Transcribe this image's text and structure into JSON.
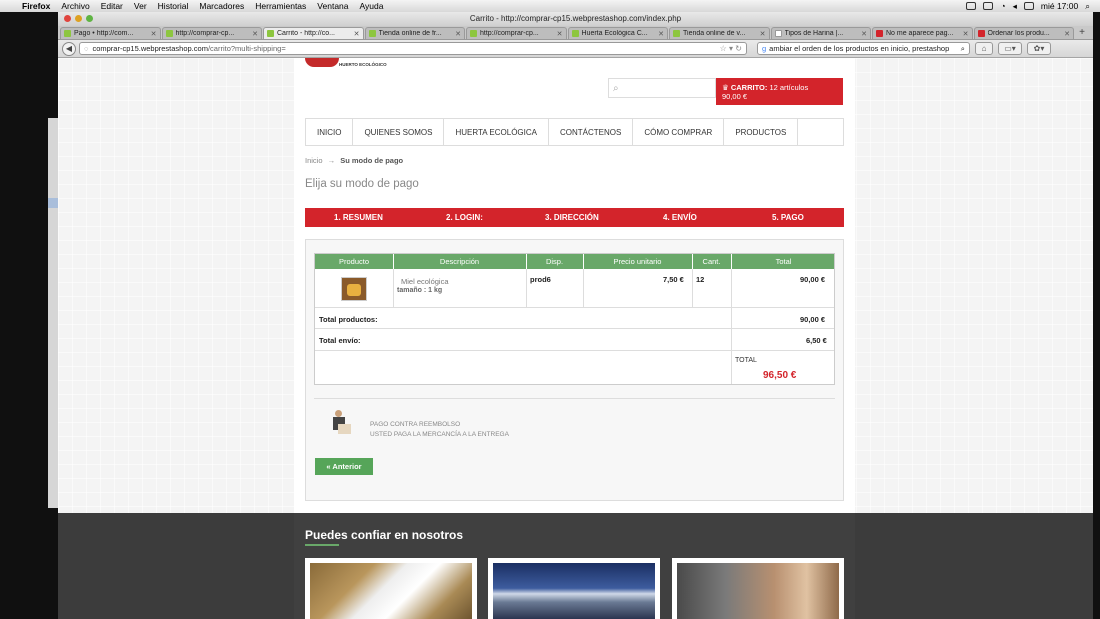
{
  "menubar": {
    "app": "Firefox",
    "items": [
      "Archivo",
      "Editar",
      "Ver",
      "Historial",
      "Marcadores",
      "Herramientas",
      "Ventana",
      "Ayuda"
    ],
    "clock": "mié 17:00"
  },
  "window": {
    "title": "Carrito - http://comprar-cp15.webprestashop.com/index.php"
  },
  "tabs": [
    {
      "label": "Pago • http://com...",
      "color": "#8dc63f",
      "active": false
    },
    {
      "label": "http://comprar-cp...",
      "color": "#8dc63f",
      "active": false
    },
    {
      "label": "Carrito - http://co...",
      "color": "#8dc63f",
      "active": true
    },
    {
      "label": "Tienda online de fr...",
      "color": "#8dc63f",
      "active": false
    },
    {
      "label": "http://comprar-cp...",
      "color": "#8dc63f",
      "active": false
    },
    {
      "label": "Huerta Ecológica C...",
      "color": "#8dc63f",
      "active": false
    },
    {
      "label": "Tienda online de v...",
      "color": "#8dc63f",
      "active": false
    },
    {
      "label": "Tipos de Harina |...",
      "color": "#ffffff",
      "active": false
    },
    {
      "label": "No me aparece pag...",
      "color": "#d3242b",
      "active": false
    },
    {
      "label": "Ordenar los produ...",
      "color": "#d3242b",
      "active": false
    }
  ],
  "browser": {
    "url_domain": "comprar-cp15.webprestashop.com",
    "url_path": "/carrito?multi-shipping=",
    "search_text": "ambiar el orden de los productos en inicio, prestashop"
  },
  "shop": {
    "logo_text": "HUERTO ECOLÓGICO",
    "cart_label": "CARRITO:",
    "cart_items": "12 artículos",
    "cart_total": "90,00 €",
    "nav": [
      "INICIO",
      "QUIENES SOMOS",
      "HUERTA ECOLÓGICA",
      "CONTÁCTENOS",
      "CÓMO COMPRAR",
      "PRODUCTOS"
    ],
    "breadcrumb_home": "Inicio",
    "breadcrumb_sep": "→",
    "breadcrumb_current": "Su modo de pago",
    "heading": "Elija su modo de pago",
    "steps": [
      "1. RESUMEN",
      "2. LOGIN:",
      "3. DIRECCIÓN",
      "4. ENVÍO",
      "5. PAGO"
    ]
  },
  "order": {
    "columns": [
      "Producto",
      "Descripción",
      "Disp.",
      "Precio unitario",
      "Cant.",
      "Total"
    ],
    "product_name": "Miel ecológica",
    "product_variant": "tamaño : 1 kg",
    "availability": "prod6",
    "unit_price": "7,50 €",
    "quantity": "12",
    "line_total": "90,00 €",
    "total_products_label": "Total productos:",
    "total_products": "90,00 €",
    "total_shipping_label": "Total envío:",
    "total_shipping": "6,50 €",
    "total_label": "TOTAL",
    "total": "96,50 €"
  },
  "payment": {
    "method_line1": "PAGO CONTRA REEMBOLSO",
    "method_line2": "USTED PAGA LA MERCANCÍA A LA ENTREGA",
    "back_button": "« Anterior"
  },
  "footer": {
    "heading": "Puedes confiar en nosotros"
  }
}
